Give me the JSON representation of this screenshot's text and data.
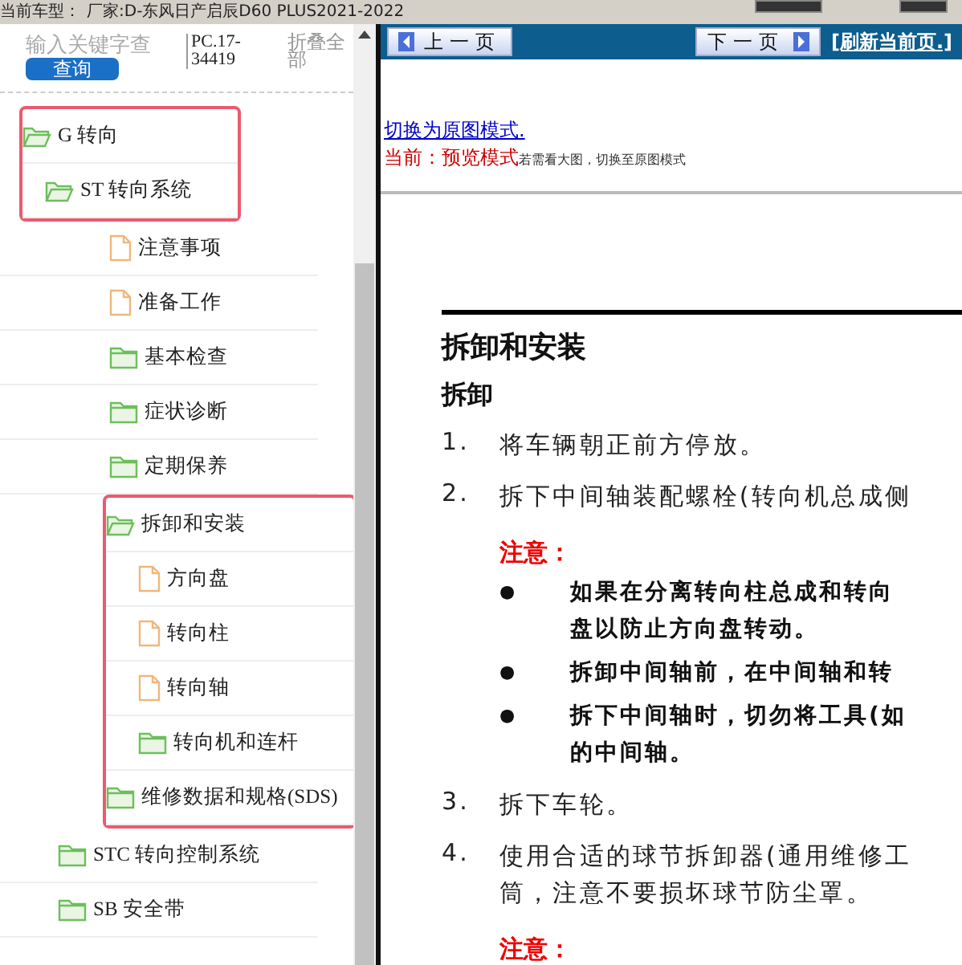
{
  "top_bar": {
    "label": "当前车型：",
    "vehicle": "厂家:D-东风日产启辰D60 PLUS2021-2022"
  },
  "sidebar": {
    "search": {
      "placeholder": "输入关键字查"
    },
    "query_button": "查询",
    "code": "PC.17-34419",
    "collapse_all": "折叠全部",
    "tree": [
      {
        "label": "G 转向",
        "kind": "folder",
        "expanded": true,
        "marked": true,
        "children": [
          {
            "label": "ST 转向系统",
            "kind": "folder",
            "expanded": true,
            "marked": true,
            "children": [
              {
                "label": "注意事项",
                "kind": "file",
                "marked": false
              },
              {
                "label": "准备工作",
                "kind": "file",
                "marked": false
              },
              {
                "label": "基本检查",
                "kind": "folder",
                "expanded": false,
                "marked": false
              },
              {
                "label": "症状诊断",
                "kind": "folder",
                "expanded": false,
                "marked": false
              },
              {
                "label": "定期保养",
                "kind": "folder",
                "expanded": false,
                "marked": false
              },
              {
                "label": "拆卸和安装",
                "kind": "folder",
                "expanded": true,
                "marked": true,
                "children": [
                  {
                    "label": "方向盘",
                    "kind": "file",
                    "marked": true
                  },
                  {
                    "label": "转向柱",
                    "kind": "file",
                    "marked": true
                  },
                  {
                    "label": "转向轴",
                    "kind": "file",
                    "marked": true
                  },
                  {
                    "label": "转向机和连杆",
                    "kind": "folder",
                    "expanded": false,
                    "marked": true
                  }
                ]
              },
              {
                "label": "维修数据和规格(SDS)",
                "kind": "folder",
                "expanded": false,
                "marked": true
              }
            ]
          },
          {
            "label": "STC 转向控制系统",
            "kind": "folder",
            "expanded": false,
            "marked": false
          },
          {
            "label": "SB 安全带",
            "kind": "folder",
            "expanded": false,
            "marked": false
          }
        ]
      }
    ]
  },
  "nav_bar": {
    "prev": "上一页",
    "next": "下一页",
    "refresh": "[刷新当前页.]"
  },
  "mode": {
    "link": "切换为原图模式.",
    "current": "当前：预览模式",
    "hint": "若需看大图，切换至原图模式"
  },
  "document": {
    "title": "拆卸和安装",
    "subtitle": "拆卸",
    "items": [
      {
        "kind": "step",
        "number": "1.",
        "lines": [
          "将车辆朝正前方停放。"
        ]
      },
      {
        "kind": "step",
        "number": "2.",
        "lines": [
          "拆下中间轴装配螺栓(转向机总成侧"
        ]
      },
      {
        "kind": "caution",
        "label": "注意：",
        "bullets": [
          {
            "bullet": "●",
            "lines": [
              "如果在分离转向柱总成和转向",
              "盘以防止方向盘转动。"
            ]
          },
          {
            "bullet": "●",
            "lines": [
              "拆卸中间轴前，在中间轴和转"
            ]
          },
          {
            "bullet": "●",
            "lines": [
              "拆下中间轴时，切勿将工具(如",
              "的中间轴。"
            ]
          }
        ]
      },
      {
        "kind": "step",
        "number": "3.",
        "lines": [
          "拆下车轮。"
        ]
      },
      {
        "kind": "step",
        "number": "4.",
        "lines": [
          "使用合适的球节拆卸器(通用维修工",
          "筒，注意不要损坏球节防尘罩。"
        ]
      },
      {
        "kind": "caution",
        "label": "注意："
      }
    ]
  }
}
